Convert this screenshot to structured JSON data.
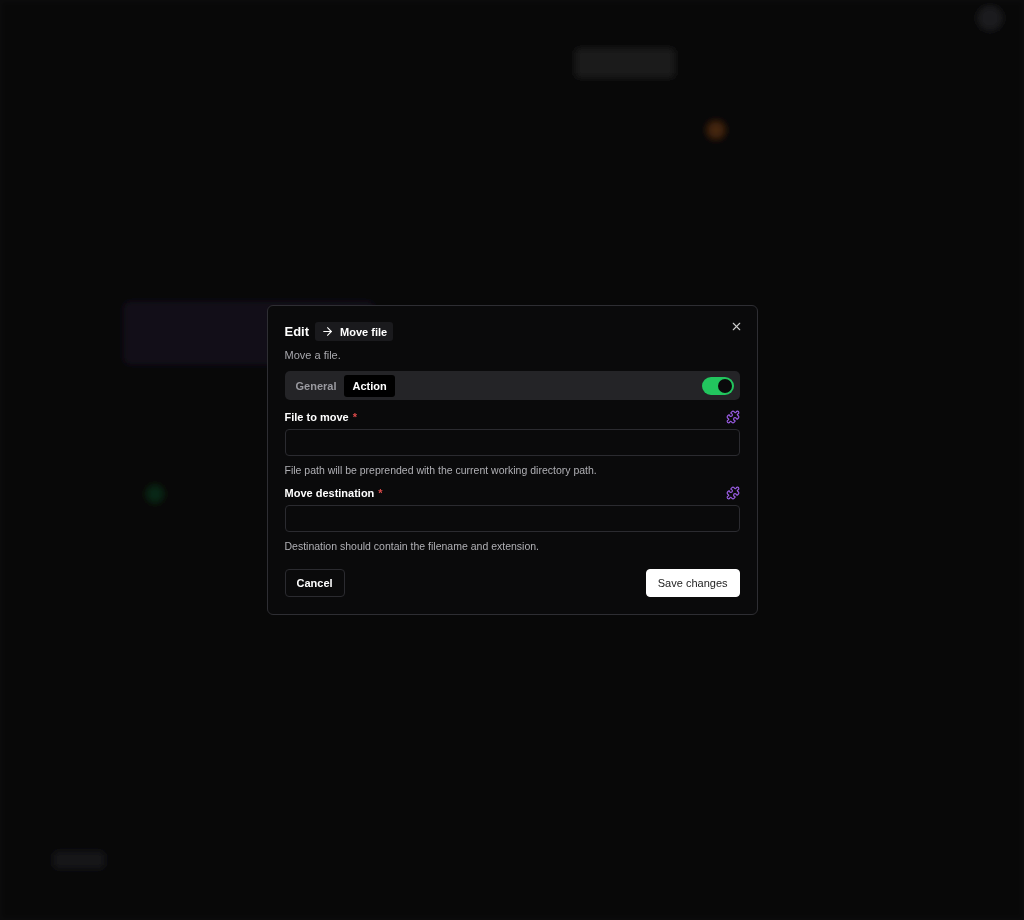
{
  "dialog": {
    "title": "Edit",
    "action_chip": "Move file",
    "description": "Move a file.",
    "tabs": [
      {
        "label": "General",
        "selected": false
      },
      {
        "label": "Action",
        "selected": true
      }
    ],
    "toggle": {
      "on": true
    },
    "fields": [
      {
        "label": "File to move",
        "required_mark": "*",
        "hint": "File path will be preprended with the current working directory path."
      },
      {
        "label": "Move destination",
        "required_mark": "*",
        "hint": "Destination should contain the filename and extension."
      }
    ],
    "buttons": [
      {
        "label": "Cancel",
        "kind": "secondary"
      },
      {
        "label": "Save changes",
        "kind": "primary"
      }
    ]
  }
}
